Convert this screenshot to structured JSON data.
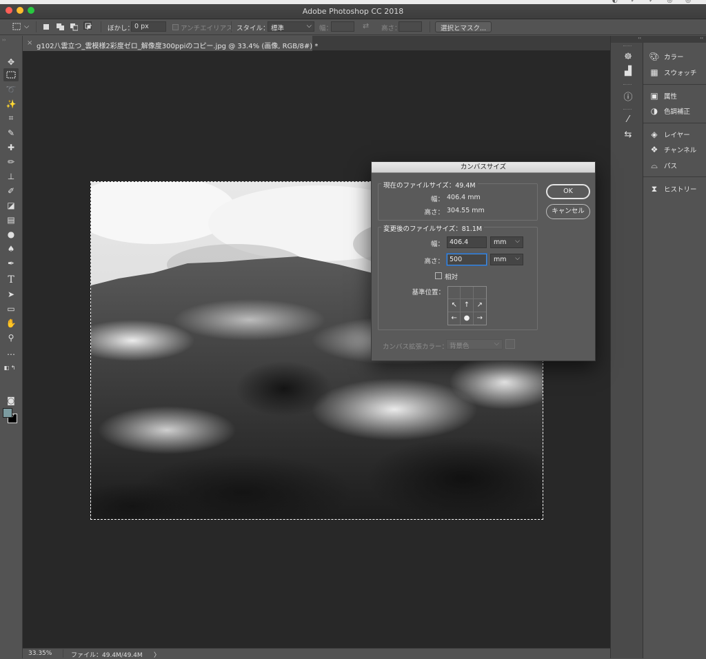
{
  "app": {
    "title": "Adobe Photoshop CC 2018"
  },
  "options_bar": {
    "feather_label": "ぼかし：",
    "feather_value": "0 px",
    "antialias_label": "アンチエイリアス",
    "style_label": "スタイル：",
    "style_value": "標準",
    "width_label": "幅：",
    "height_label": "高さ：",
    "select_mask_button": "選択とマスク..."
  },
  "document_tab": {
    "name": "g102八雲立つ_雲模様2彩度ゼロ_解像度300ppiのコピー.jpg @ 33.4% (画像, RGB/8#) *"
  },
  "status_bar": {
    "zoom": "33.35%",
    "file_info": "ファイル：49.4M/49.4M",
    "arrow": "〉"
  },
  "right_panels": {
    "items": [
      {
        "label": "カラー",
        "icon": "palette-icon"
      },
      {
        "label": "スウォッチ",
        "icon": "grid-icon"
      },
      {
        "label": "属性",
        "icon": "properties-icon"
      },
      {
        "label": "色調補正",
        "icon": "adjustment-icon"
      },
      {
        "label": "レイヤー",
        "icon": "layers-icon"
      },
      {
        "label": "チャンネル",
        "icon": "channels-icon"
      },
      {
        "label": "パス",
        "icon": "paths-icon"
      },
      {
        "label": "ヒストリー",
        "icon": "history-icon"
      }
    ]
  },
  "canvas_size_dialog": {
    "title": "カンバスサイズ",
    "current_size_legend": "現在のファイルサイズ：49.4M",
    "current_width_label": "幅：",
    "current_width_value": "406.4 mm",
    "current_height_label": "高さ：",
    "current_height_value": "304.55 mm",
    "new_size_legend": "変更後のファイルサイズ：81.1M",
    "new_width_label": "幅：",
    "new_width_value": "406.4",
    "new_width_unit": "mm",
    "new_height_label": "高さ：",
    "new_height_value": "500",
    "new_height_unit": "mm",
    "relative_label": "相対",
    "anchor_label": "基準位置：",
    "extension_color_label": "カンバス拡張カラー：",
    "extension_color_value": "背景色",
    "ok_button": "OK",
    "cancel_button": "キャンセル"
  }
}
